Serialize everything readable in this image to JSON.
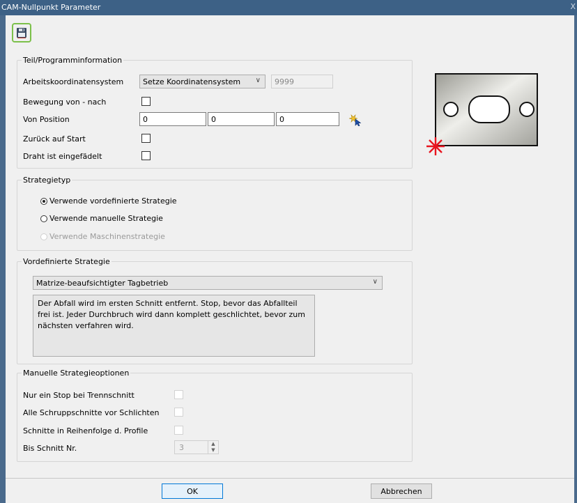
{
  "window": {
    "title": "CAM-Nullpunkt Parameter",
    "close_glyph": "X"
  },
  "toolbar": {
    "save_icon": "floppy-disk-icon"
  },
  "teil": {
    "legend": "Teil/Programminformation",
    "arbeitskoordinatensystem_label": "Arbeitskoordinatensystem",
    "koordinatensystem_value": "Setze Koordinatensystem",
    "koordinatensystem_number": "9999",
    "bewegung_label": "Bewegung von - nach",
    "von_position_label": "Von Position",
    "von_position": [
      "0",
      "0",
      "0"
    ],
    "pick_icon": "pick-position-icon",
    "zurueck_label": "Zurück auf Start",
    "draht_label": "Draht ist eingefädelt"
  },
  "strategietyp": {
    "legend": "Strategietyp",
    "options": [
      {
        "label": "Verwende vordefinierte Strategie",
        "checked": true,
        "disabled": false
      },
      {
        "label": "Verwende manuelle Strategie",
        "checked": false,
        "disabled": false
      },
      {
        "label": "Verwende Maschinenstrategie",
        "checked": false,
        "disabled": true
      }
    ]
  },
  "vordefiniert": {
    "legend": "Vordefinierte Strategie",
    "selected": "Matrize-beaufsichtigter Tagbetrieb",
    "description": "Der Abfall wird im ersten Schnitt entfernt. Stop, bevor das Abfallteil frei ist. Jeder Durchbruch wird dann komplett geschlichtet, bevor zum nächsten verfahren wird."
  },
  "manuell": {
    "legend": "Manuelle Strategieoptionen",
    "nur_ein_stop_label": "Nur ein Stop bei Trennschnitt",
    "alle_schrupp_label": "Alle Schruppschnitte vor Schlichten",
    "reihenfolge_label": "Schnitte in Reihenfolge d. Profile",
    "bis_schnitt_label": "Bis Schnitt Nr.",
    "bis_schnitt_value": "3"
  },
  "buttons": {
    "ok": "OK",
    "cancel": "Abbrechen"
  },
  "colors": {
    "accent_green": "#7cc04a",
    "marker_red": "#e8141e",
    "title_bar": "#3d6186"
  }
}
